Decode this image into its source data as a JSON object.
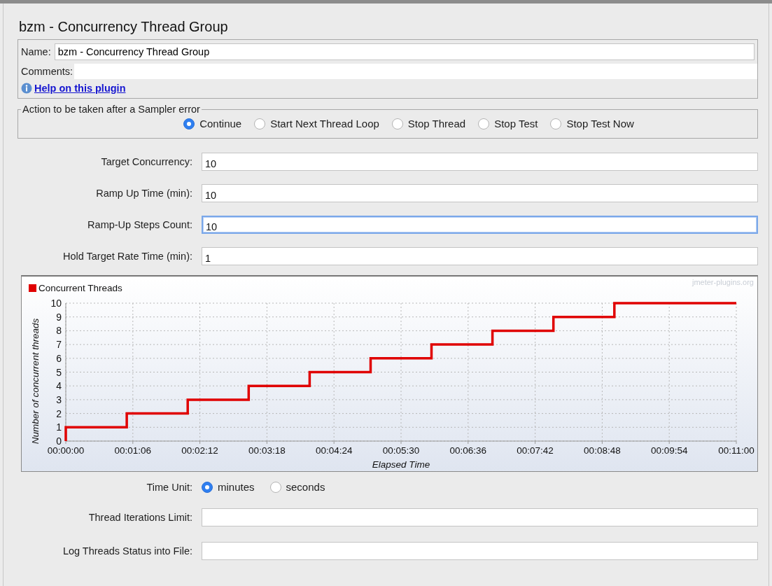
{
  "title": "bzm - Concurrency Thread Group",
  "name_field": {
    "label": "Name:",
    "value": "bzm - Concurrency Thread Group"
  },
  "comments_field": {
    "label": "Comments:"
  },
  "help_link": "Help on this plugin",
  "sampler_error": {
    "legend": "Action to be taken after a Sampler error",
    "options": [
      {
        "label": "Continue",
        "selected": true
      },
      {
        "label": "Start Next Thread Loop",
        "selected": false
      },
      {
        "label": "Stop Thread",
        "selected": false
      },
      {
        "label": "Stop Test",
        "selected": false
      },
      {
        "label": "Stop Test Now",
        "selected": false
      }
    ]
  },
  "fields": [
    {
      "label": "Target Concurrency:",
      "value": "10",
      "focused": false
    },
    {
      "label": "Ramp Up Time (min):",
      "value": "10",
      "focused": false
    },
    {
      "label": "Ramp-Up Steps Count:",
      "value": "10",
      "focused": true
    },
    {
      "label": "Hold Target Rate Time (min):",
      "value": "1",
      "focused": false
    }
  ],
  "chart": {
    "watermark": "jmeter-plugins.org",
    "chart_data": {
      "type": "line",
      "grid": true,
      "xlabel": "Elapsed Time",
      "ylabel": "Number of concurrent threads",
      "x": [
        0,
        0,
        60,
        60,
        120,
        120,
        180,
        180,
        240,
        240,
        300,
        300,
        360,
        360,
        420,
        420,
        480,
        480,
        540,
        540,
        660
      ],
      "series": [
        {
          "name": "Concurrent Threads",
          "color": "#e00000",
          "values": [
            0,
            1,
            1,
            2,
            2,
            3,
            3,
            4,
            4,
            5,
            5,
            6,
            6,
            7,
            7,
            8,
            8,
            9,
            9,
            10,
            10
          ]
        }
      ],
      "xlim": [
        0,
        660
      ],
      "ylim": [
        0,
        10
      ],
      "xticks": [
        {
          "value": 0,
          "label": "00:00:00"
        },
        {
          "value": 66,
          "label": "00:01:06"
        },
        {
          "value": 132,
          "label": "00:02:12"
        },
        {
          "value": 198,
          "label": "00:03:18"
        },
        {
          "value": 264,
          "label": "00:04:24"
        },
        {
          "value": 330,
          "label": "00:05:30"
        },
        {
          "value": 396,
          "label": "00:06:36"
        },
        {
          "value": 462,
          "label": "00:07:42"
        },
        {
          "value": 528,
          "label": "00:08:48"
        },
        {
          "value": 594,
          "label": "00:09:54"
        },
        {
          "value": 660,
          "label": "00:11:00"
        }
      ],
      "yticks": [
        0,
        1,
        2,
        3,
        4,
        5,
        6,
        7,
        8,
        9,
        10
      ]
    }
  },
  "time_unit": {
    "label": "Time Unit:",
    "options": [
      {
        "label": "minutes",
        "selected": true
      },
      {
        "label": "seconds",
        "selected": false
      }
    ]
  },
  "extra_fields": [
    {
      "label": "Thread Iterations Limit:"
    },
    {
      "label": "Log Threads Status into File:"
    }
  ]
}
